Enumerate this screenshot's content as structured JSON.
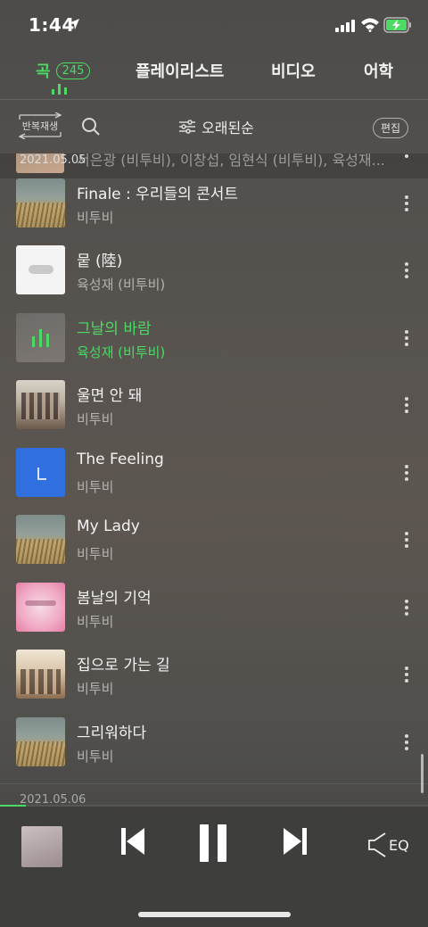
{
  "status": {
    "time": "1:44"
  },
  "tabs": [
    {
      "label": "곡",
      "badge": "245",
      "active": true
    },
    {
      "label": "플레이리스트"
    },
    {
      "label": "비디오"
    },
    {
      "label": "어학"
    }
  ],
  "toolbar": {
    "repeat_label": "반복재생",
    "sort_label": "오래된순",
    "edit_label": "편집"
  },
  "partial_row": {
    "artist": "서은광 (비투비), 이창섭, 임현식 (비투비), 육성재...",
    "date": "2021.05.05"
  },
  "songs": [
    {
      "title": "Finale : 우리들의 콘서트",
      "artist": "비투비",
      "thumb": "wheat"
    },
    {
      "title": "뭍 (陸)",
      "artist": "육성재 (비투비)",
      "thumb": "white"
    },
    {
      "title": "그날의 바람",
      "artist": "육성재 (비투비)",
      "thumb": "dim",
      "active": true
    },
    {
      "title": "울면 안 돼",
      "artist": "비투비",
      "thumb": "group"
    },
    {
      "title": "The Feeling",
      "artist": "비투비",
      "thumb": "blue"
    },
    {
      "title": "My Lady",
      "artist": "비투비",
      "thumb": "wheat"
    },
    {
      "title": "봄날의 기억",
      "artist": "비투비",
      "thumb": "pink"
    },
    {
      "title": "집으로 가는 길",
      "artist": "비투비",
      "thumb": "imean"
    },
    {
      "title": "그리워하다",
      "artist": "비투비",
      "thumb": "wheat"
    }
  ],
  "next_date": "2021.05.06",
  "player": {
    "progress": 0.06,
    "eq_label": "EQ"
  },
  "colors": {
    "accent": "#4cd964"
  }
}
